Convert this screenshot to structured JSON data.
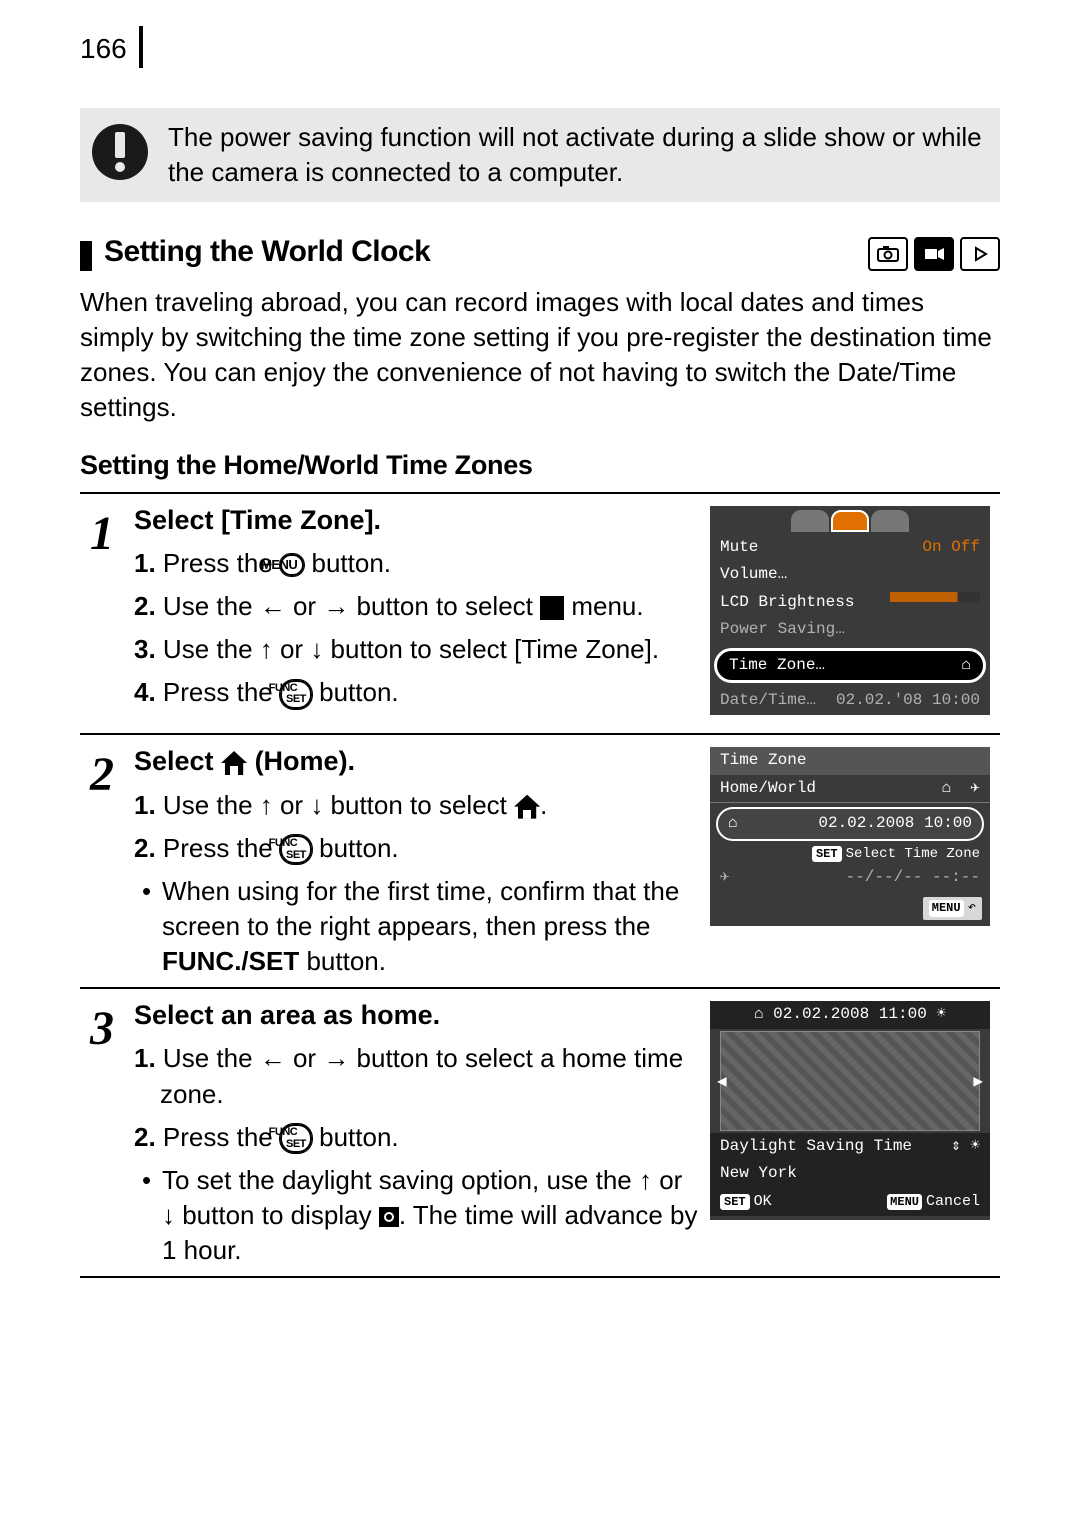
{
  "page_number": "166",
  "warning_text": "The power saving function will not activate during a slide show or while the camera is connected to a computer.",
  "section_title": "Setting the World Clock",
  "intro_text": "When traveling abroad, you can record images with local dates and times simply by switching the time zone setting if you pre-register the destination time zones. You can enjoy the convenience of not having to switch the Date/Time settings.",
  "subheading": "Setting the Home/World Time Zones",
  "steps": {
    "s1": {
      "num": "1",
      "title": "Select [Time Zone].",
      "i1a": "1.",
      "i1b_pre": "Press the ",
      "i1b_btn": "MENU",
      "i1b_post": " button.",
      "i2a": "2.",
      "i2b": "Use the ← or → button to select ",
      "i2c": " menu.",
      "i3a": "3.",
      "i3b": "Use the ↑ or ↓ button to select [Time Zone].",
      "i4a": "4.",
      "i4b_pre": "Press the ",
      "i4b_btn": "FUNC\nSET",
      "i4b_post": " button.",
      "lcd": {
        "mute": "Mute",
        "onoff": "On Off",
        "volume": "Volume…",
        "bright": "LCD Brightness",
        "power": "Power Saving…",
        "tz": "Time Zone…",
        "dt": "Date/Time…",
        "dtv": "02.02.'08 10:00"
      }
    },
    "s2": {
      "num": "2",
      "title_pre": "Select ",
      "title_post": " (Home).",
      "i1a": "1.",
      "i1b": "Use the ↑ or ↓ button to select ",
      "i1c": ".",
      "i2a": "2.",
      "i2b_pre": "Press the ",
      "i2b_btn": "FUNC\nSET",
      "i2b_post": " button.",
      "bullet_pre": "When using for the first time, confirm that the screen to the right appears, then press the ",
      "bullet_bold": "FUNC./SET",
      "bullet_post": " button.",
      "lcd": {
        "title": "Time Zone",
        "hw": "Home/World",
        "date": "02.02.2008 10:00",
        "select": "Select Time Zone",
        "dash": "--/--/-- --:--",
        "menu": "MENU"
      }
    },
    "s3": {
      "num": "3",
      "title": "Select an area as home.",
      "i1a": "1.",
      "i1b": "Use the ← or → button to select a home time zone.",
      "i2a": "2.",
      "i2b_pre": "Press the ",
      "i2b_btn": "FUNC\nSET",
      "i2b_post": " button.",
      "bullet": "To set the daylight saving option, use the ↑ or ↓ button to display ",
      "bullet_post": ". The time will advance by 1 hour.",
      "lcd": {
        "date": "02.02.2008 11:00",
        "dst": "Daylight Saving Time",
        "city": "New York",
        "ok": "OK",
        "cancel": "Cancel"
      }
    }
  }
}
